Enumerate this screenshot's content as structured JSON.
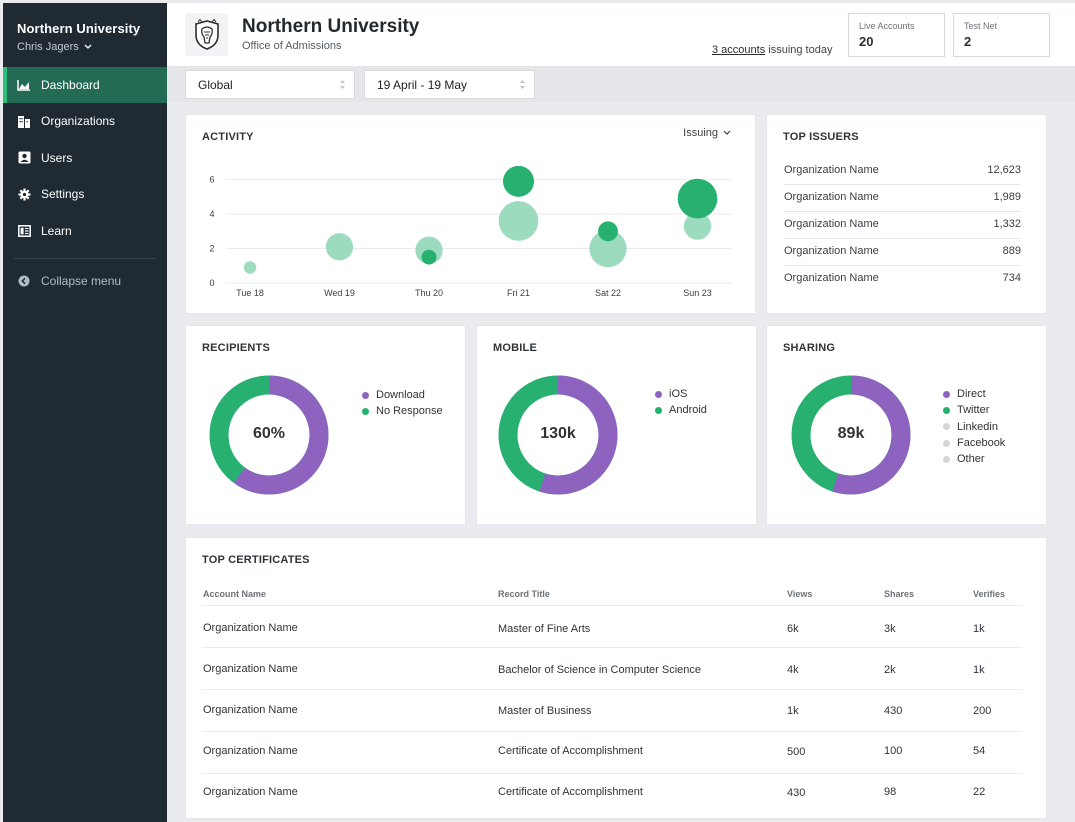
{
  "sidebar": {
    "org_name": "Northern University",
    "user_name": "Chris Jagers",
    "items": [
      {
        "label": "Dashboard",
        "icon": "chart-icon",
        "active": true
      },
      {
        "label": "Organizations",
        "icon": "buildings-icon"
      },
      {
        "label": "Users",
        "icon": "user-card-icon"
      },
      {
        "label": "Settings",
        "icon": "gear-icon"
      },
      {
        "label": "Learn",
        "icon": "book-icon"
      }
    ],
    "collapse_label": "Collapse menu"
  },
  "header": {
    "title": "Northern University",
    "subtitle": "Office of Admissions",
    "issuing_link": "3 accounts",
    "issuing_text": " issuing today",
    "stats": [
      {
        "label": "Live Accounts",
        "value": "20"
      },
      {
        "label": "Test Net",
        "value": "2"
      }
    ]
  },
  "filters": {
    "scope": "Global",
    "date_range": "19 April - 19 May"
  },
  "activity": {
    "title": "ACTIVITY",
    "dropdown": "Issuing"
  },
  "chart_data": {
    "type": "scatter",
    "title": "ACTIVITY",
    "categories": [
      "Tue 18",
      "Wed 19",
      "Thu 20",
      "Fri 21",
      "Sat 22",
      "Sun 23"
    ],
    "y_ticks": [
      0,
      2,
      4,
      6
    ],
    "ylim": [
      0,
      6.5
    ],
    "grid": true,
    "series": [
      {
        "color": "#97d9b9",
        "points": [
          {
            "x": "Tue 18",
            "y": 0.9,
            "size": 1
          },
          {
            "x": "Wed 19",
            "y": 2.1,
            "size": 2.2
          },
          {
            "x": "Thu 20",
            "y": 1.9,
            "size": 2.2
          },
          {
            "x": "Fri 21",
            "y": 3.6,
            "size": 3.2
          },
          {
            "x": "Sat 22",
            "y": 2.0,
            "size": 3.0
          },
          {
            "x": "Sun 23",
            "y": 3.3,
            "size": 2.2
          }
        ]
      },
      {
        "color": "#27b06f",
        "points": [
          {
            "x": "Thu 20",
            "y": 1.5,
            "size": 1.2
          },
          {
            "x": "Fri 21",
            "y": 5.9,
            "size": 2.5
          },
          {
            "x": "Sat 22",
            "y": 3.0,
            "size": 1.6
          },
          {
            "x": "Sun 23",
            "y": 4.9,
            "size": 3.2
          }
        ]
      }
    ]
  },
  "top_issuers": {
    "title": "TOP ISSUERS",
    "rows": [
      {
        "name": "Organization Name",
        "value": "12,623"
      },
      {
        "name": "Organization Name",
        "value": "1,989"
      },
      {
        "name": "Organization Name",
        "value": "1,332"
      },
      {
        "name": "Organization Name",
        "value": "889"
      },
      {
        "name": "Organization Name",
        "value": "734"
      }
    ]
  },
  "recipients": {
    "title": "RECIPIENTS",
    "center": "60%",
    "legend": [
      {
        "label": "Download",
        "color": "#8e63c0"
      },
      {
        "label": "No Response",
        "color": "#27b06f"
      }
    ],
    "share": [
      0.6,
      0.4
    ]
  },
  "mobile": {
    "title": "MOBILE",
    "center": "130k",
    "legend": [
      {
        "label": "iOS",
        "color": "#8e63c0"
      },
      {
        "label": "Android",
        "color": "#27b06f"
      }
    ],
    "share": [
      0.55,
      0.45
    ]
  },
  "sharing": {
    "title": "SHARING",
    "center": "89k",
    "legend": [
      {
        "label": "Direct",
        "color": "#8e63c0"
      },
      {
        "label": "Twitter",
        "color": "#27b06f"
      },
      {
        "label": "Linkedin",
        "color": "#d3d6d9"
      },
      {
        "label": "Facebook",
        "color": "#d3d6d9"
      },
      {
        "label": "Other",
        "color": "#d3d6d9"
      }
    ],
    "share": [
      0.55,
      0.45
    ]
  },
  "top_certificates": {
    "title": "TOP CERTIFICATES",
    "columns": [
      "Account Name",
      "Record Title",
      "Views",
      "Shares",
      "Verifies"
    ],
    "rows": [
      [
        "Organization Name",
        "Master of Fine Arts",
        "6k",
        "3k",
        "1k"
      ],
      [
        "Organization Name",
        "Bachelor of Science in Computer Science",
        "4k",
        "2k",
        "1k"
      ],
      [
        "Organization Name",
        "Master of Business",
        "1k",
        "430",
        "200"
      ],
      [
        "Organization Name",
        "Certificate of Accomplishment",
        "500",
        "100",
        "54"
      ],
      [
        "Organization Name",
        "Certificate of Accomplishment",
        "430",
        "98",
        "22"
      ]
    ]
  },
  "colors": {
    "sidebar_bg": "#1f2a33",
    "accent_green": "#27b06f",
    "light_green": "#97d9b9",
    "purple": "#8e63c0"
  }
}
